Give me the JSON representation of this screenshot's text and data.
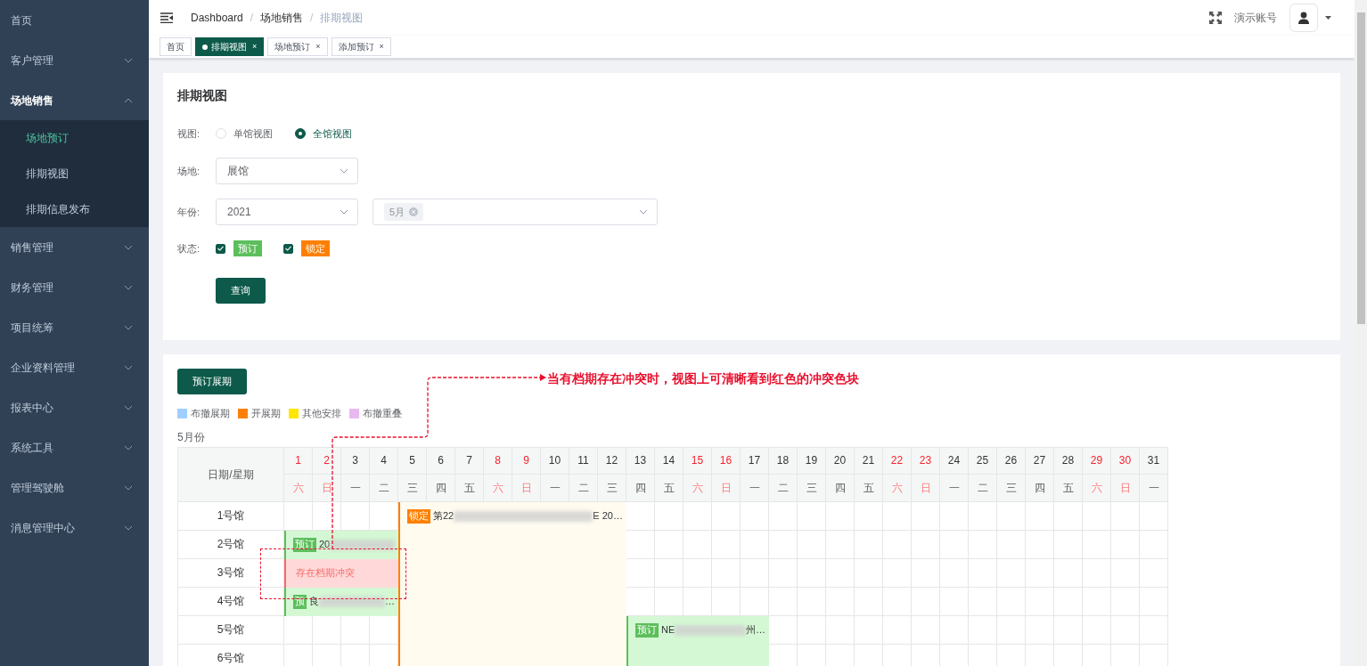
{
  "sidebar": {
    "items": [
      {
        "label": "首页"
      },
      {
        "label": "客户管理",
        "expanded": false
      },
      {
        "label": "场地销售",
        "expanded": true,
        "children": [
          {
            "label": "场地预订",
            "selected": true
          },
          {
            "label": "排期视图",
            "selected": false
          },
          {
            "label": "排期信息发布",
            "selected": false
          }
        ]
      },
      {
        "label": "销售管理",
        "expanded": false
      },
      {
        "label": "财务管理",
        "expanded": false
      },
      {
        "label": "项目统筹",
        "expanded": false
      },
      {
        "label": "企业资料管理",
        "expanded": false
      },
      {
        "label": "报表中心",
        "expanded": false
      },
      {
        "label": "系统工具",
        "expanded": false
      },
      {
        "label": "管理驾驶舱",
        "expanded": false
      },
      {
        "label": "消息管理中心",
        "expanded": false
      }
    ]
  },
  "breadcrumb": [
    {
      "label": "Dashboard"
    },
    {
      "separator": "/",
      "label": "场地销售"
    },
    {
      "separator": "/",
      "label": "排期视图"
    }
  ],
  "user": {
    "name": "演示账号"
  },
  "tabs": [
    {
      "label": "首页",
      "selected": false
    },
    {
      "label": "排期视图",
      "selected": true,
      "close": "×"
    },
    {
      "label": "场地预订",
      "selected": false,
      "close": "×"
    },
    {
      "label": "添加预订",
      "selected": false,
      "close": "×"
    }
  ],
  "filter": {
    "title": "排期视图",
    "view": {
      "label": "视图:",
      "options": [
        {
          "label": "单馆视图",
          "selected": false
        },
        {
          "label": "全馆视图",
          "selected": true
        }
      ]
    },
    "venue": {
      "label": "场地:",
      "value": "展馆"
    },
    "year": {
      "label": "年份:",
      "value": "2021",
      "months": [
        "5月"
      ]
    },
    "status": {
      "label": "状态:",
      "options": [
        {
          "label": "预订",
          "checked": true,
          "color": "#5cbf5c"
        },
        {
          "label": "锁定",
          "checked": true,
          "color": "#ff7f00"
        }
      ]
    },
    "query_button": "查询"
  },
  "schedule": {
    "book_button": "预订展期",
    "legend": [
      {
        "label": "布撤展期",
        "color": "#a0cfff"
      },
      {
        "label": "开展期",
        "color": "#ff7f00"
      },
      {
        "label": "其他安排",
        "color": "#ffe600"
      },
      {
        "label": "布撤重叠",
        "color": "#e8b9f0"
      }
    ],
    "month": "5月份",
    "corner": "日期/星期",
    "days": [
      {
        "day": "1",
        "weekday": "六",
        "weekend": true
      },
      {
        "day": "2",
        "weekday": "日",
        "weekend": true
      },
      {
        "day": "3",
        "weekday": "一",
        "weekend": false
      },
      {
        "day": "4",
        "weekday": "二",
        "weekend": false
      },
      {
        "day": "5",
        "weekday": "三",
        "weekend": false
      },
      {
        "day": "6",
        "weekday": "四",
        "weekend": false
      },
      {
        "day": "7",
        "weekday": "五",
        "weekend": false
      },
      {
        "day": "8",
        "weekday": "六",
        "weekend": true
      },
      {
        "day": "9",
        "weekday": "日",
        "weekend": true
      },
      {
        "day": "10",
        "weekday": "一",
        "weekend": false
      },
      {
        "day": "11",
        "weekday": "二",
        "weekend": false
      },
      {
        "day": "12",
        "weekday": "三",
        "weekend": false
      },
      {
        "day": "13",
        "weekday": "四",
        "weekend": false
      },
      {
        "day": "14",
        "weekday": "五",
        "weekend": false
      },
      {
        "day": "15",
        "weekday": "六",
        "weekend": true
      },
      {
        "day": "16",
        "weekday": "日",
        "weekend": true
      },
      {
        "day": "17",
        "weekday": "一",
        "weekend": false
      },
      {
        "day": "18",
        "weekday": "二",
        "weekend": false
      },
      {
        "day": "19",
        "weekday": "三",
        "weekend": false
      },
      {
        "day": "20",
        "weekday": "四",
        "weekend": false
      },
      {
        "day": "21",
        "weekday": "五",
        "weekend": false
      },
      {
        "day": "22",
        "weekday": "六",
        "weekend": true
      },
      {
        "day": "23",
        "weekday": "日",
        "weekend": true
      },
      {
        "day": "24",
        "weekday": "一",
        "weekend": false
      },
      {
        "day": "25",
        "weekday": "二",
        "weekend": false
      },
      {
        "day": "26",
        "weekday": "三",
        "weekend": false
      },
      {
        "day": "27",
        "weekday": "四",
        "weekend": false
      },
      {
        "day": "28",
        "weekday": "五",
        "weekend": false
      },
      {
        "day": "29",
        "weekday": "六",
        "weekend": true
      },
      {
        "day": "30",
        "weekday": "日",
        "weekend": true
      },
      {
        "day": "31",
        "weekday": "一",
        "weekend": false
      }
    ],
    "halls": [
      "1号馆",
      "2号馆",
      "3号馆",
      "4号馆",
      "5号馆",
      "6号馆"
    ],
    "events": [
      {
        "kind": "locked",
        "tag": "锁定",
        "text_start": "第22",
        "blurred": true,
        "text_end": "E 20…"
      },
      {
        "kind": "booked",
        "tag": "预订",
        "text_start": "20",
        "blurred": true
      },
      {
        "kind": "conflict",
        "text_start": "存在档期冲突",
        "blurred": false
      },
      {
        "kind": "booked",
        "tag": "预",
        "text_start": "良",
        "blurred": true,
        "text_end": "…"
      },
      {
        "kind": "booked",
        "tag": "预订",
        "text_start": "NE",
        "blurred": true,
        "text_end": "州…"
      }
    ]
  },
  "annotation": {
    "text": "当有档期存在冲突时，视图上可清晰看到红色的冲突色块"
  }
}
